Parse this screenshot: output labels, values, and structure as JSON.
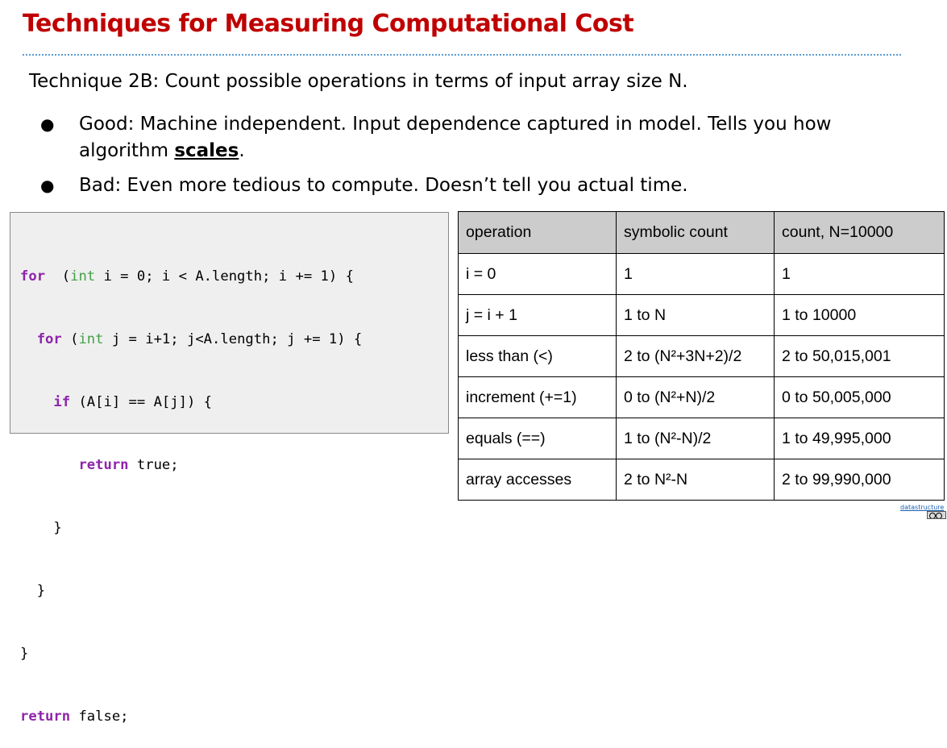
{
  "title": "Techniques for Measuring Computational Cost",
  "intro": "Technique 2B: Count possible operations in terms of input array size N.",
  "bullets": {
    "good_prefix": "Good: Machine independent. Input dependence captured in model. Tells you how algorithm ",
    "good_emphasis": "scales",
    "good_suffix": ".",
    "bad": "Bad: Even more tedious to compute. Doesn’t tell you actual time."
  },
  "code": {
    "line1": [
      [
        "kw",
        "for"
      ],
      [
        "",
        "  ("
      ],
      [
        "ty",
        "int"
      ],
      [
        "",
        " i = 0; i < A.length; i += 1) {"
      ]
    ],
    "line2": [
      [
        "",
        "  "
      ],
      [
        "kw",
        "for"
      ],
      [
        "",
        " ("
      ],
      [
        "ty",
        "int"
      ],
      [
        "",
        " j = i+1; j<A.length; j += 1) {"
      ]
    ],
    "line3": [
      [
        "",
        "    "
      ],
      [
        "kw",
        "if"
      ],
      [
        "",
        " (A[i] == A[j]) {"
      ]
    ],
    "line4": [
      [
        "",
        "       "
      ],
      [
        "kw",
        "return"
      ],
      [
        "",
        " true;"
      ]
    ],
    "line5": [
      [
        "",
        "    }"
      ]
    ],
    "line6": [
      [
        "",
        "  }"
      ]
    ],
    "line7": [
      [
        "",
        "}"
      ]
    ],
    "line8": [
      [
        "kw",
        "return"
      ],
      [
        "",
        " false;"
      ]
    ]
  },
  "table": {
    "headers": [
      "operation",
      "symbolic count",
      "count, N=10000"
    ],
    "rows": [
      [
        "i = 0",
        "1",
        "1"
      ],
      [
        "j = i + 1",
        "1 to N",
        "1 to 10000"
      ],
      [
        "less than (<)",
        "2 to (N²+3N+2)/2",
        "2 to 50,015,001"
      ],
      [
        "increment (+=1)",
        "0 to (N²+N)/2",
        "0 to 50,005,000"
      ],
      [
        "equals (==)",
        "1 to (N²-N)/2",
        "1 to 49,995,000"
      ],
      [
        "array accesses",
        "2 to N²-N",
        "2 to 99,990,000"
      ]
    ]
  },
  "footer": {
    "link_text": "datastructure"
  },
  "colors": {
    "title": "#c00000",
    "keyword": "#8e24aa",
    "type": "#43a047",
    "rule": "#5b9bd5"
  }
}
